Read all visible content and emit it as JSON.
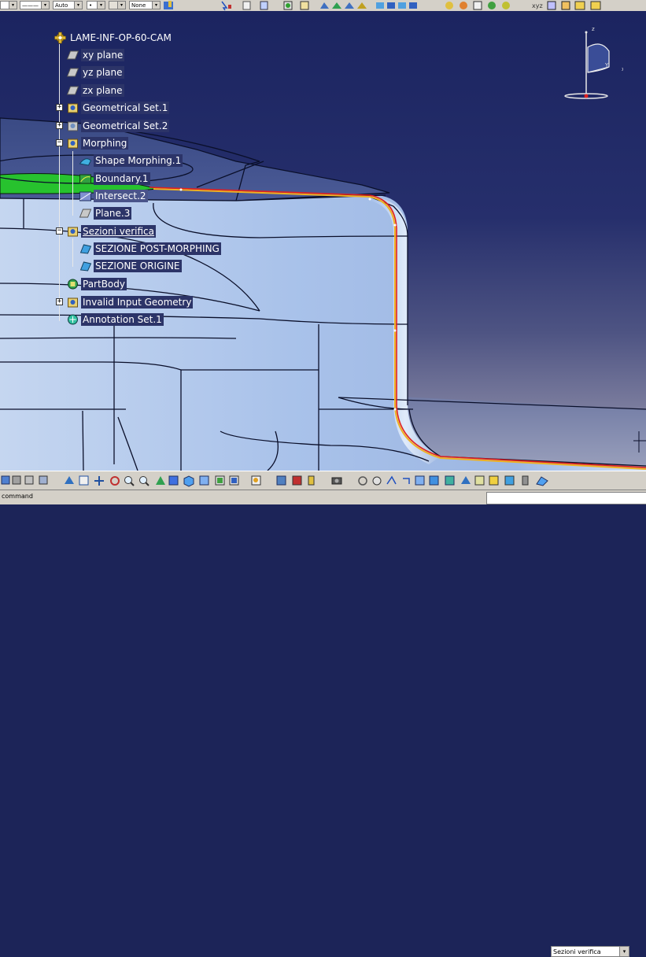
{
  "top_toolbar": {
    "line_style": "———",
    "thickness": "Auto",
    "point": "•",
    "layer": "None"
  },
  "tree": {
    "root": "LAME-INF-OP-60-CAM",
    "nodes": [
      {
        "label": "xy plane",
        "icon": "plane-icon"
      },
      {
        "label": "yz plane",
        "icon": "plane-icon"
      },
      {
        "label": "zx plane",
        "icon": "plane-icon"
      },
      {
        "label": "Geometrical Set.1",
        "icon": "geometrical-set-icon",
        "expander": "+"
      },
      {
        "label": "Geometrical Set.2",
        "icon": "geometrical-set-icon",
        "expander": "+"
      },
      {
        "label": "Morphing",
        "icon": "geometrical-set-icon",
        "expander": "−"
      },
      {
        "label": "Shape Morphing.1",
        "icon": "shape-morphing-icon"
      },
      {
        "label": "Boundary.1",
        "icon": "boundary-icon"
      },
      {
        "label": "Intersect.2",
        "icon": "intersect-icon"
      },
      {
        "label": "Plane.3",
        "icon": "plane-icon"
      },
      {
        "label": "Sezioni verifica",
        "icon": "geometrical-set-icon",
        "expander": "−"
      },
      {
        "label": "SEZIONE POST-MORPHING",
        "icon": "surface-icon"
      },
      {
        "label": "SEZIONE ORIGINE",
        "icon": "surface-icon"
      },
      {
        "label": "PartBody",
        "icon": "partbody-icon"
      },
      {
        "label": "Invalid Input Geometry",
        "icon": "geometrical-set-icon",
        "expander": "+"
      },
      {
        "label": "Annotation Set.1",
        "icon": "annotation-icon"
      }
    ]
  },
  "compass": {
    "z": "z",
    "y": "Y",
    "x": "x"
  },
  "bottom_toolbar": {
    "current_set": "Sezioni verifica"
  },
  "status": {
    "prompt": "command",
    "command_value": ""
  },
  "colors": {
    "background_top": "#1b2460",
    "background_bottom": "#9a98ae",
    "part_surface": "#a9c4ea",
    "boundary_curve": "#e02020",
    "section_curve": "#f0b020",
    "green_face": "#27c22e"
  }
}
